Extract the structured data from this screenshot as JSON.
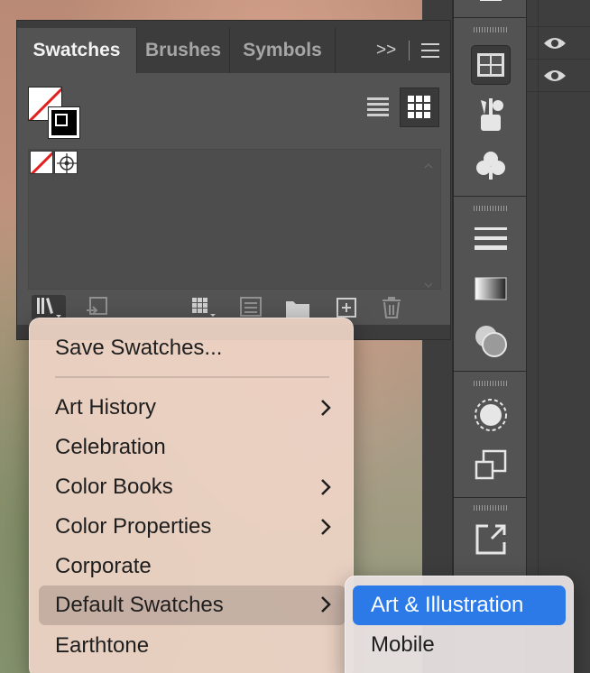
{
  "swatches_panel": {
    "tabs": [
      {
        "label": "Swatches",
        "active": true
      },
      {
        "label": "Brushes",
        "active": false
      },
      {
        "label": "Symbols",
        "active": false
      }
    ],
    "overflow_label": ">>",
    "menu_icon": "hamburger-icon",
    "view_modes": [
      "list-view-icon",
      "thumbnail-view-icon"
    ],
    "active_view": "thumbnail-view-icon",
    "swatches": [
      {
        "name": "None",
        "icon": "none-swatch-icon"
      },
      {
        "name": "Registration",
        "icon": "registration-swatch-icon"
      }
    ],
    "bottom_tools": [
      "swatch-libraries-menu-icon",
      "place-swatches-icon",
      "show-swatch-kinds-icon",
      "swatch-options-icon",
      "new-color-group-icon",
      "new-swatch-icon",
      "delete-swatch-icon"
    ]
  },
  "library_menu": {
    "items": [
      {
        "label": "Save Swatches...",
        "submenu": false
      },
      {
        "label": "Art History",
        "submenu": true
      },
      {
        "label": "Celebration",
        "submenu": false
      },
      {
        "label": "Color Books",
        "submenu": true
      },
      {
        "label": "Color Properties",
        "submenu": true
      },
      {
        "label": "Corporate",
        "submenu": false
      },
      {
        "label": "Default Swatches",
        "submenu": true,
        "highlighted": true
      },
      {
        "label": "Earthtone",
        "submenu": false
      }
    ]
  },
  "default_swatches_submenu": {
    "items": [
      {
        "label": "Art & Illustration",
        "selected": true
      },
      {
        "label": "Mobile",
        "selected": false
      }
    ]
  },
  "colors": {
    "panel_bg": "#535353",
    "tab_bar_bg": "#3c3c3c",
    "menu_bg": "#eed4c6",
    "selection_blue": "#2b7ae8"
  }
}
